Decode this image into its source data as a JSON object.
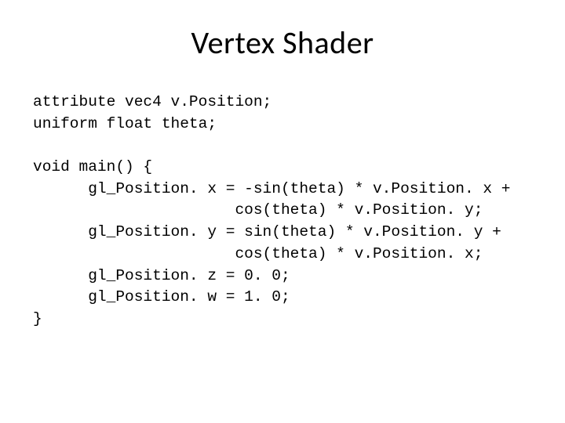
{
  "title": "Vertex Shader",
  "code": {
    "l1": "attribute vec4 v.Position;",
    "l2": "uniform float theta;",
    "l3": "",
    "l4": "void main() {",
    "l5": "      gl_Position. x = -sin(theta) * v.Position. x +",
    "l6": "                      cos(theta) * v.Position. y;",
    "l7": "      gl_Position. y = sin(theta) * v.Position. y +",
    "l8": "                      cos(theta) * v.Position. x;",
    "l9": "      gl_Position. z = 0. 0;",
    "l10": "      gl_Position. w = 1. 0;",
    "l11": "}"
  }
}
